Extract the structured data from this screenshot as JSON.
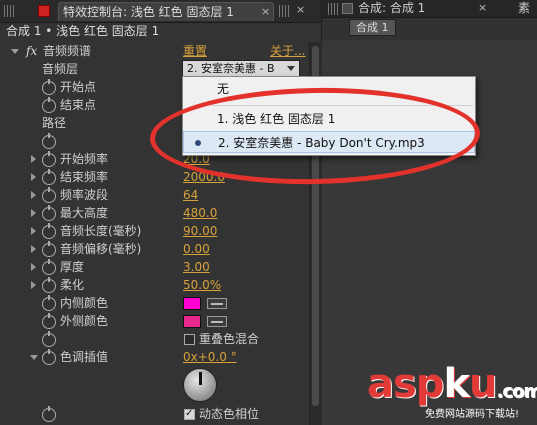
{
  "left_panel": {
    "tab_title": "特效控制台: 浅色 红色 固态层 1",
    "tab_close": "×",
    "tab2_close": "×",
    "breadcrumb": "合成 1 • 浅色 红色 固态层 1",
    "effect": {
      "fx_label": "fx",
      "name": "音频频谱",
      "reset": "重置",
      "about": "关于...",
      "audio_layer_label": "音频层",
      "audio_layer_value": "2. 安室奈美惠 - B"
    },
    "dropdown_options": [
      {
        "label": "无"
      },
      {
        "label": "1. 浅色 红色 固态层 1"
      },
      {
        "label": "2. 安室奈美惠 - Baby Don't Cry.mp3"
      }
    ],
    "props": [
      {
        "label": "开始点",
        "value": ""
      },
      {
        "label": "结束点",
        "value": ""
      },
      {
        "label": "路径",
        "value": ""
      },
      {
        "label": "开始频率",
        "value": "20.0"
      },
      {
        "label": "结束频率",
        "value": "2000.0"
      },
      {
        "label": "频率波段",
        "value": "64"
      },
      {
        "label": "最大高度",
        "value": "480.0"
      },
      {
        "label": "音频长度(毫秒)",
        "value": "90.00"
      },
      {
        "label": "音频偏移(毫秒)",
        "value": "0.00"
      },
      {
        "label": "厚度",
        "value": "3.00"
      },
      {
        "label": "柔化",
        "value": "50.0%"
      },
      {
        "label": "内侧颜色",
        "value": ""
      },
      {
        "label": "外侧颜色",
        "value": ""
      },
      {
        "label": "重叠色混合",
        "value": ""
      },
      {
        "label": "色调插值",
        "value": "0x+0.0 °"
      },
      {
        "label": "动态色相位",
        "value": ""
      }
    ],
    "colors": {
      "inside": "#ff00d2",
      "outside": "#e8288f"
    }
  },
  "right_panel": {
    "tab_title": "合成: 合成 1",
    "tab_close": "×",
    "tab_extra": "素",
    "comp_chip": "合成 1"
  },
  "watermark": {
    "brand_main": "asp",
    "brand_k": "k",
    "brand_tail": "u",
    "brand_tld": ".com",
    "sub": "免费网站源码下载站!"
  }
}
